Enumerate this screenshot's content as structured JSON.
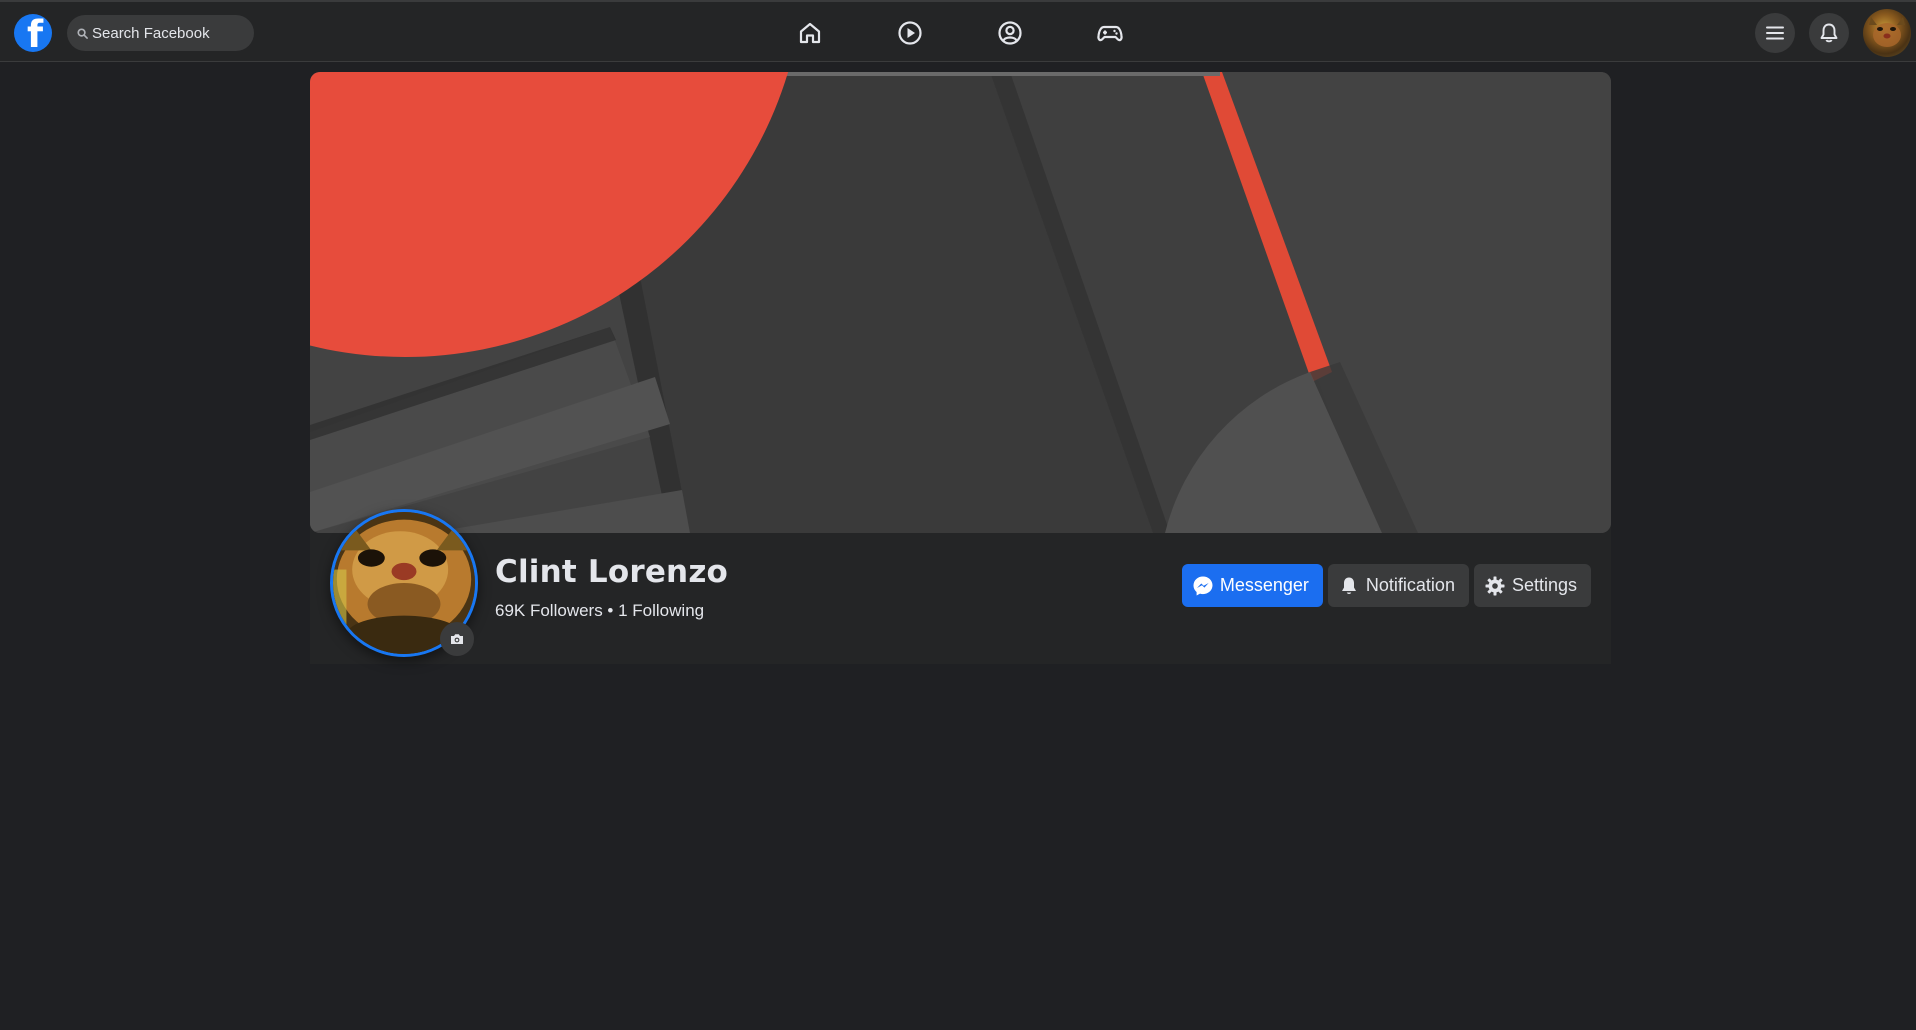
{
  "topbar": {
    "logo_letter": "f",
    "search_placeholder": "Search Facebook",
    "nav": [
      {
        "icon": "home-icon"
      },
      {
        "icon": "watch-icon"
      },
      {
        "icon": "profile-icon"
      },
      {
        "icon": "gaming-icon"
      }
    ],
    "right": [
      {
        "icon": "menu-icon"
      },
      {
        "icon": "bell-icon"
      },
      {
        "icon": "account-avatar"
      }
    ]
  },
  "profile": {
    "name": "Clint Lorenzo",
    "stats": "69K Followers • 1 Following",
    "actions": {
      "messenger_label": "Messenger",
      "notification_label": "Notification",
      "settings_label": "Settings"
    }
  },
  "colors": {
    "accent": "#1877f2",
    "background": "#1f2023",
    "surface": "#242526",
    "cover_red": "#e74c3c"
  }
}
